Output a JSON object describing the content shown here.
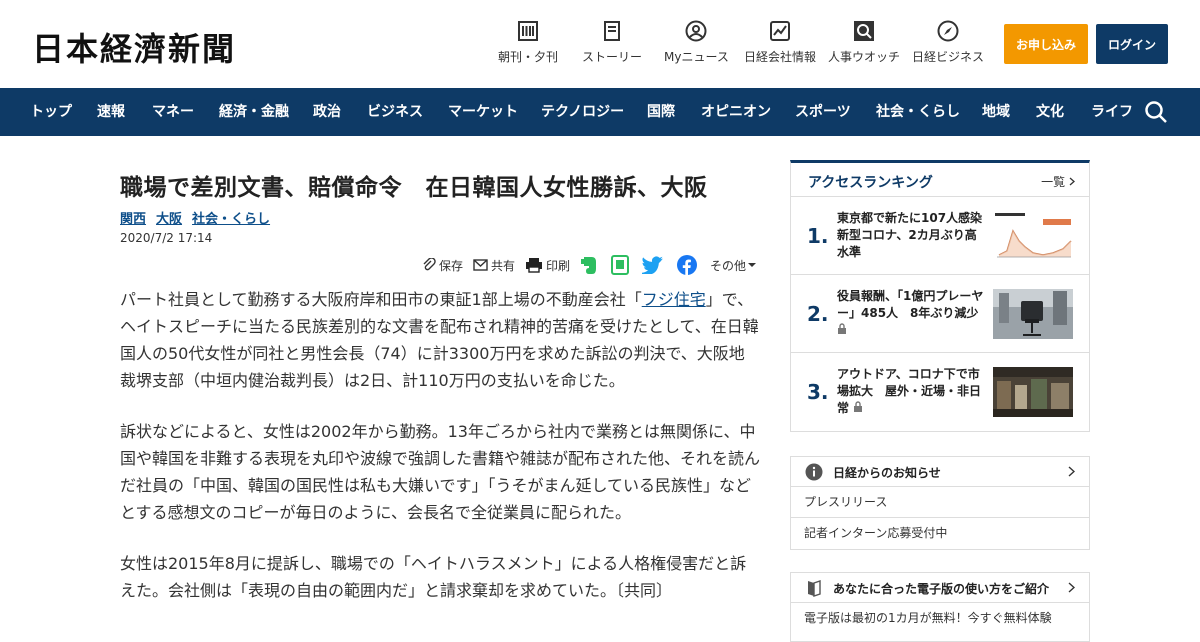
{
  "header": {
    "logo": "日本経濟新聞",
    "utilities": [
      {
        "label": "朝刊・夕刊",
        "icon": "newspaper-icon"
      },
      {
        "label": "ストーリー",
        "icon": "document-icon"
      },
      {
        "label": "Myニュース",
        "icon": "user-icon"
      },
      {
        "label": "日経会社情報",
        "icon": "chart-icon"
      },
      {
        "label": "人事ウオッチ",
        "icon": "search-person-icon"
      },
      {
        "label": "日経ビジネス",
        "icon": "compass-icon"
      }
    ],
    "subscribe_label": "お申し込み",
    "login_label": "ログイン"
  },
  "nav": {
    "items": [
      "トップ",
      "速報",
      "マネー",
      "経済・金融",
      "政治",
      "ビジネス",
      "マーケット",
      "テクノロジー",
      "国際",
      "オピニオン",
      "スポーツ",
      "社会・くらし",
      "地域",
      "文化",
      "ライフ"
    ]
  },
  "article": {
    "headline": "職場で差別文書、賠償命令　在日韓国人女性勝訴、大阪",
    "tags": [
      "関西",
      "大阪",
      "社会・くらし"
    ],
    "date": "2020/7/2 17:14",
    "share": {
      "save": "保存",
      "share": "共有",
      "print": "印刷",
      "other": "その他"
    },
    "p1_before": "パート社員として勤務する大阪府岸和田市の東証1部上場の不動産会社「",
    "p1_link": "フジ住宅",
    "p1_after": "」で、ヘイトスピーチに当たる民族差別的な文書を配布され精神的苦痛を受けたとして、在日韓国人の50代女性が同社と男性会長（74）に計3300万円を求めた訴訟の判決で、大阪地裁堺支部（中垣内健治裁判長）は2日、計110万円の支払いを命じた。",
    "p2": "訴状などによると、女性は2002年から勤務。13年ごろから社内で業務とは無関係に、中国や韓国を非難する表現を丸印や波線で強調した書籍や雑誌が配布された他、それを読んだ社員の「中国、韓国の国民性は私も大嫌いです」「うそがまん延している民族性」などとする感想文のコピーが毎日のように、会長名で全従業員に配られた。",
    "p3": "女性は2015年8月に提訴し、職場での「ヘイトハラスメント」による人格権侵害だと訴えた。会社側は「表現の自由の範囲内だ」と請求棄却を求めていた。〔共同〕"
  },
  "ranking": {
    "title": "アクセスランキング",
    "more": "一覧",
    "items": [
      {
        "num": "1.",
        "text": "東京都で新たに107人感染　新型コロナ、2カ月ぶり高水準",
        "locked": false
      },
      {
        "num": "2.",
        "text": "役員報酬、「1億円プレーヤー」485人　8年ぶり減少",
        "locked": true
      },
      {
        "num": "3.",
        "text": "アウトドア、コロナ下で市場拡大　屋外・近場・非日常",
        "locked": true
      }
    ]
  },
  "notice": {
    "title": "日経からのお知らせ",
    "rows": [
      "プレスリリース",
      "記者インターン応募受付中"
    ]
  },
  "guide": {
    "title": "あなたに合った電子版の使い方をご紹介",
    "row": "電子版は最初の1カ月が無料！今すぐ無料体験"
  }
}
